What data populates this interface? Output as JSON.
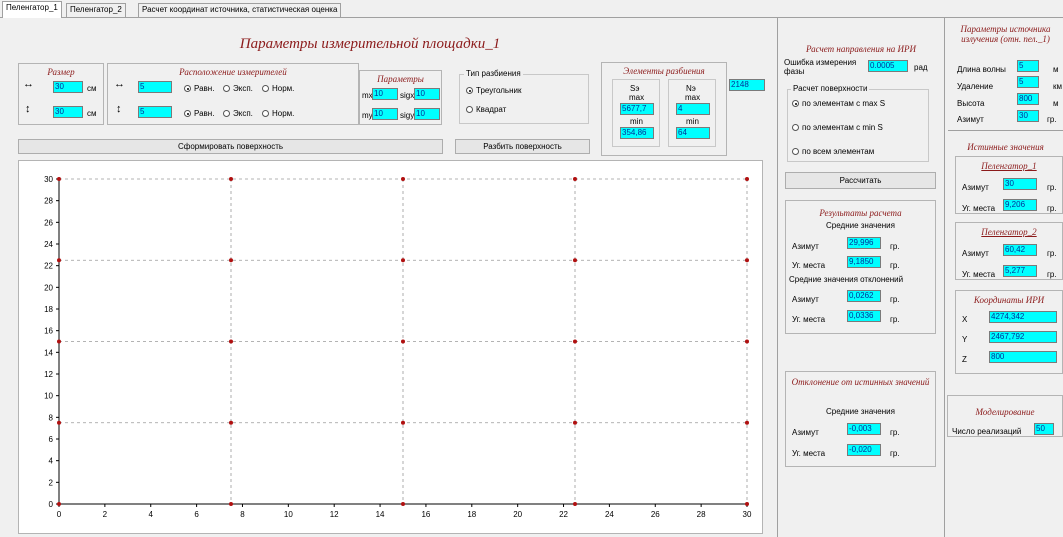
{
  "tabs": [
    "Пеленгатор_1",
    "Пеленгатор_2",
    "Расчет координат источника, статистическая оценка"
  ],
  "main_title": "Параметры измерительной площадки_1",
  "size": {
    "title": "Размер",
    "w": "30",
    "h": "30",
    "unit": "см"
  },
  "layout": {
    "title": "Расположение измерителей",
    "x_count": "5",
    "y_count": "5",
    "options": [
      "Равн.",
      "Эксп.",
      "Норм."
    ],
    "selected_x": "Равн.",
    "selected_y": "Равн."
  },
  "params": {
    "title": "Параметры",
    "mx_label": "mx",
    "mx": "10",
    "sigx_label": "sigx",
    "sigx": "10",
    "my_label": "my",
    "my": "10",
    "sigy_label": "sigy",
    "sigy": "10"
  },
  "partition_type": {
    "title": "Тип разбиения",
    "options": [
      "Треугольник",
      "Квадрат"
    ],
    "selected": "Треугольник"
  },
  "elements": {
    "title": "Элементы разбиения",
    "count": "2148",
    "s_label": "Sэ",
    "n_label": "Nэ",
    "max_label": "max",
    "min_label": "min",
    "s_max": "5677,7",
    "s_min": "354,86",
    "n_max": "4",
    "n_min": "64"
  },
  "buttons": {
    "form_surface": "Сформировать поверхность",
    "split_surface": "Разбить поверхность",
    "calculate": "Рассчитать"
  },
  "direction": {
    "title": "Расчет направления на ИРИ",
    "phase_error_label": "Ошибка измерения фазы",
    "phase_error": "0.0005",
    "phase_unit": "рад",
    "surface_group": "Расчет поверхности",
    "surface_options": [
      "по элементам с max S",
      "по элементам с min S",
      "по всем элементам"
    ],
    "surface_selected": "по элементам с max S"
  },
  "results": {
    "title": "Результаты расчета",
    "mean_label": "Средние значения",
    "azimuth_label": "Азимут",
    "azimuth": "29,996",
    "elevation_label": "Уг. места",
    "elevation": "9,1850",
    "dev_label": "Средние значения отклонений",
    "dev_azimuth": "0,0262",
    "dev_elevation": "0,0336",
    "unit": "гр."
  },
  "deviation": {
    "title": "Отклонение от истинных значений",
    "mean_label": "Средние значения",
    "azimuth": "-0,003",
    "elevation": "-0,020"
  },
  "source": {
    "title": "Параметры источника излучения (отн. пел._1)",
    "wavelength_label": "Длина волны",
    "wavelength": "5",
    "wavelength_unit": "м",
    "distance_label": "Удаление",
    "distance": "5",
    "distance_unit": "км",
    "height_label": "Высота",
    "height": "800",
    "height_unit": "м",
    "azimuth_label": "Азимут",
    "azimuth": "30",
    "azimuth_unit": "гр."
  },
  "true_values": {
    "title": "Истинные значения",
    "p1": {
      "title": "Пеленгатор_1",
      "azimuth": "30",
      "elevation": "9,206"
    },
    "p2": {
      "title": "Пеленгатор_2",
      "azimuth": "60,42",
      "elevation": "5,277"
    }
  },
  "coords": {
    "title": "Координаты ИРИ",
    "x_label": "X",
    "x": "4274,342",
    "y_label": "Y",
    "y": "2467,792",
    "z_label": "Z",
    "z": "800"
  },
  "modeling": {
    "title": "Моделирование",
    "runs_label": "Число реализаций",
    "runs": "50"
  },
  "chart_data": {
    "type": "scatter",
    "xlim": [
      0,
      30
    ],
    "ylim": [
      0,
      30
    ],
    "xticks": [
      0,
      2,
      4,
      6,
      8,
      10,
      12,
      14,
      16,
      18,
      20,
      22,
      24,
      26,
      28,
      30
    ],
    "yticks": [
      0,
      2,
      4,
      6,
      8,
      10,
      12,
      14,
      16,
      18,
      20,
      22,
      24,
      26,
      28,
      30
    ],
    "x_grid": [
      0,
      7.5,
      15,
      22.5,
      30
    ],
    "y_grid": [
      0,
      7.5,
      15,
      22.5,
      30
    ],
    "grid": true,
    "point_color": "#b01010"
  }
}
